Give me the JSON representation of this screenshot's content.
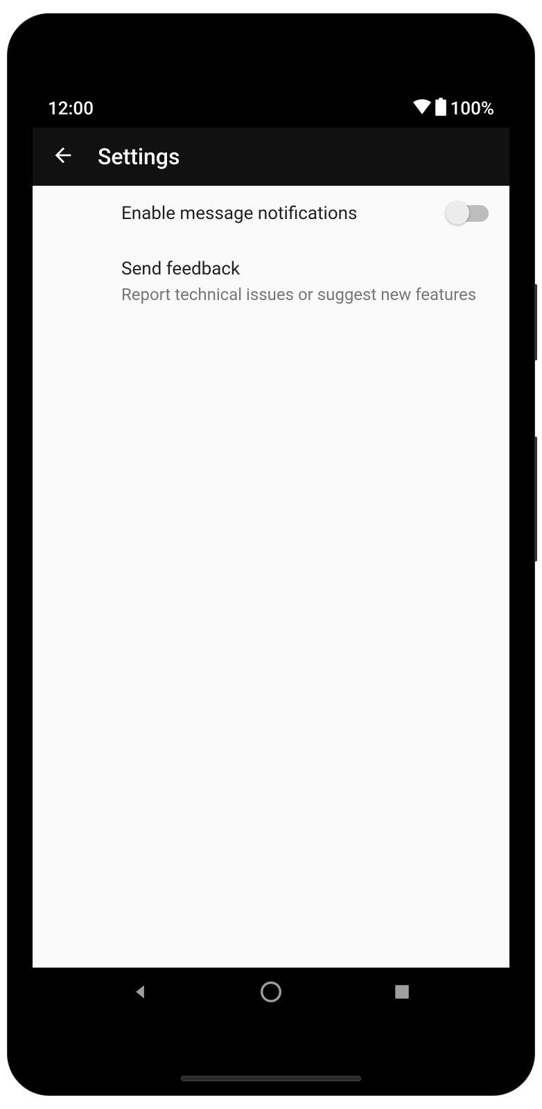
{
  "status_bar": {
    "time": "12:00",
    "battery_pct": "100%"
  },
  "app_bar": {
    "title": "Settings"
  },
  "settings": {
    "items": [
      {
        "title": "Enable message notifications",
        "subtitle": "",
        "has_switch": true,
        "switch_on": false
      },
      {
        "title": "Send feedback",
        "subtitle": "Report technical issues or suggest new features",
        "has_switch": false
      }
    ]
  }
}
